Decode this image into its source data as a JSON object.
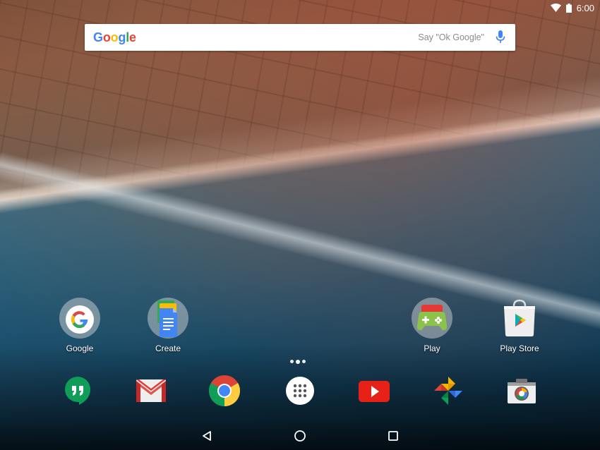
{
  "status_bar": {
    "time": "6:00",
    "icons": [
      "wifi-icon",
      "battery-icon"
    ]
  },
  "search": {
    "logo": [
      "G",
      "o",
      "o",
      "g",
      "l",
      "e"
    ],
    "logo_colors": [
      "#4285F4",
      "#EA4335",
      "#FBBC05",
      "#4285F4",
      "#34A853",
      "#EA4335"
    ],
    "hint": "Say \"Ok Google\"",
    "mic_color": "#4285F4"
  },
  "home_apps": [
    {
      "label": "Google",
      "icon": "google-folder-icon"
    },
    {
      "label": "Create",
      "icon": "docs-folder-icon"
    },
    {
      "label": "Play",
      "icon": "play-games-folder-icon"
    },
    {
      "label": "Play Store",
      "icon": "play-store-icon"
    }
  ],
  "dock": [
    {
      "name": "hangouts",
      "icon": "hangouts-icon",
      "color": "#0F9D58"
    },
    {
      "name": "gmail",
      "icon": "gmail-icon",
      "color": "#DB4437"
    },
    {
      "name": "chrome",
      "icon": "chrome-icon",
      "color": "#4285F4"
    },
    {
      "name": "all-apps",
      "icon": "app-drawer-icon",
      "color": "#FFFFFF"
    },
    {
      "name": "youtube",
      "icon": "youtube-icon",
      "color": "#E62117"
    },
    {
      "name": "photos",
      "icon": "photos-icon",
      "color": "#FBBC05"
    },
    {
      "name": "camera",
      "icon": "camera-icon",
      "color": "#9E9E9E"
    }
  ],
  "page_indicator": {
    "pages": 3,
    "current": 2
  },
  "nav_bar": {
    "buttons": [
      "back-icon",
      "home-icon",
      "recents-icon"
    ]
  }
}
